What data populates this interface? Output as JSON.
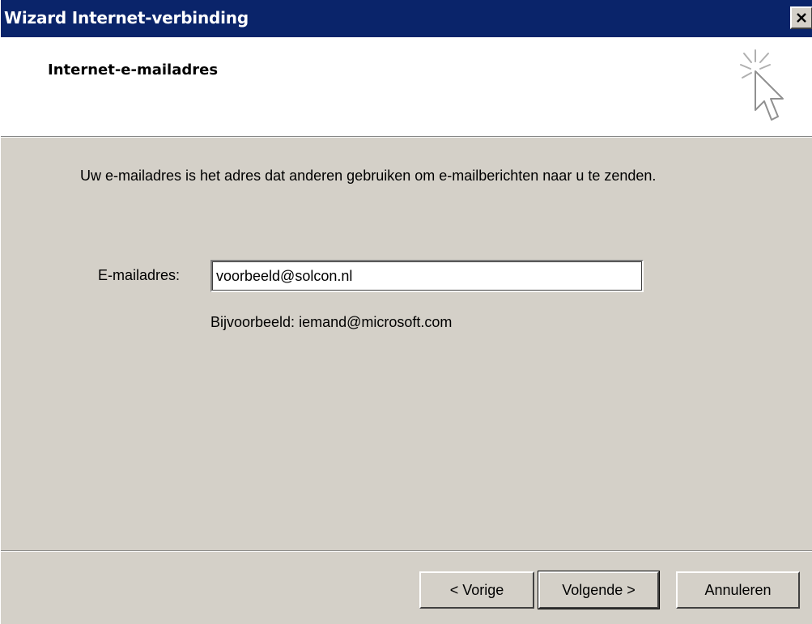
{
  "window": {
    "title": "Wizard Internet-verbinding"
  },
  "header": {
    "title": "Internet-e-mailadres",
    "icon": "wizard-cursor-icon"
  },
  "content": {
    "intro": "Uw e-mailadres is het adres dat anderen gebruiken om e-mailberichten naar u te zenden.",
    "email_label": "E-mailadres:",
    "email_value": "voorbeeld@solcon.nl",
    "example": "Bijvoorbeeld: iemand@microsoft.com"
  },
  "buttons": {
    "back": "< Vorige",
    "next": "Volgende >",
    "cancel": "Annuleren"
  },
  "colors": {
    "titlebar": "#0a246a",
    "face": "#d4d0c8"
  }
}
